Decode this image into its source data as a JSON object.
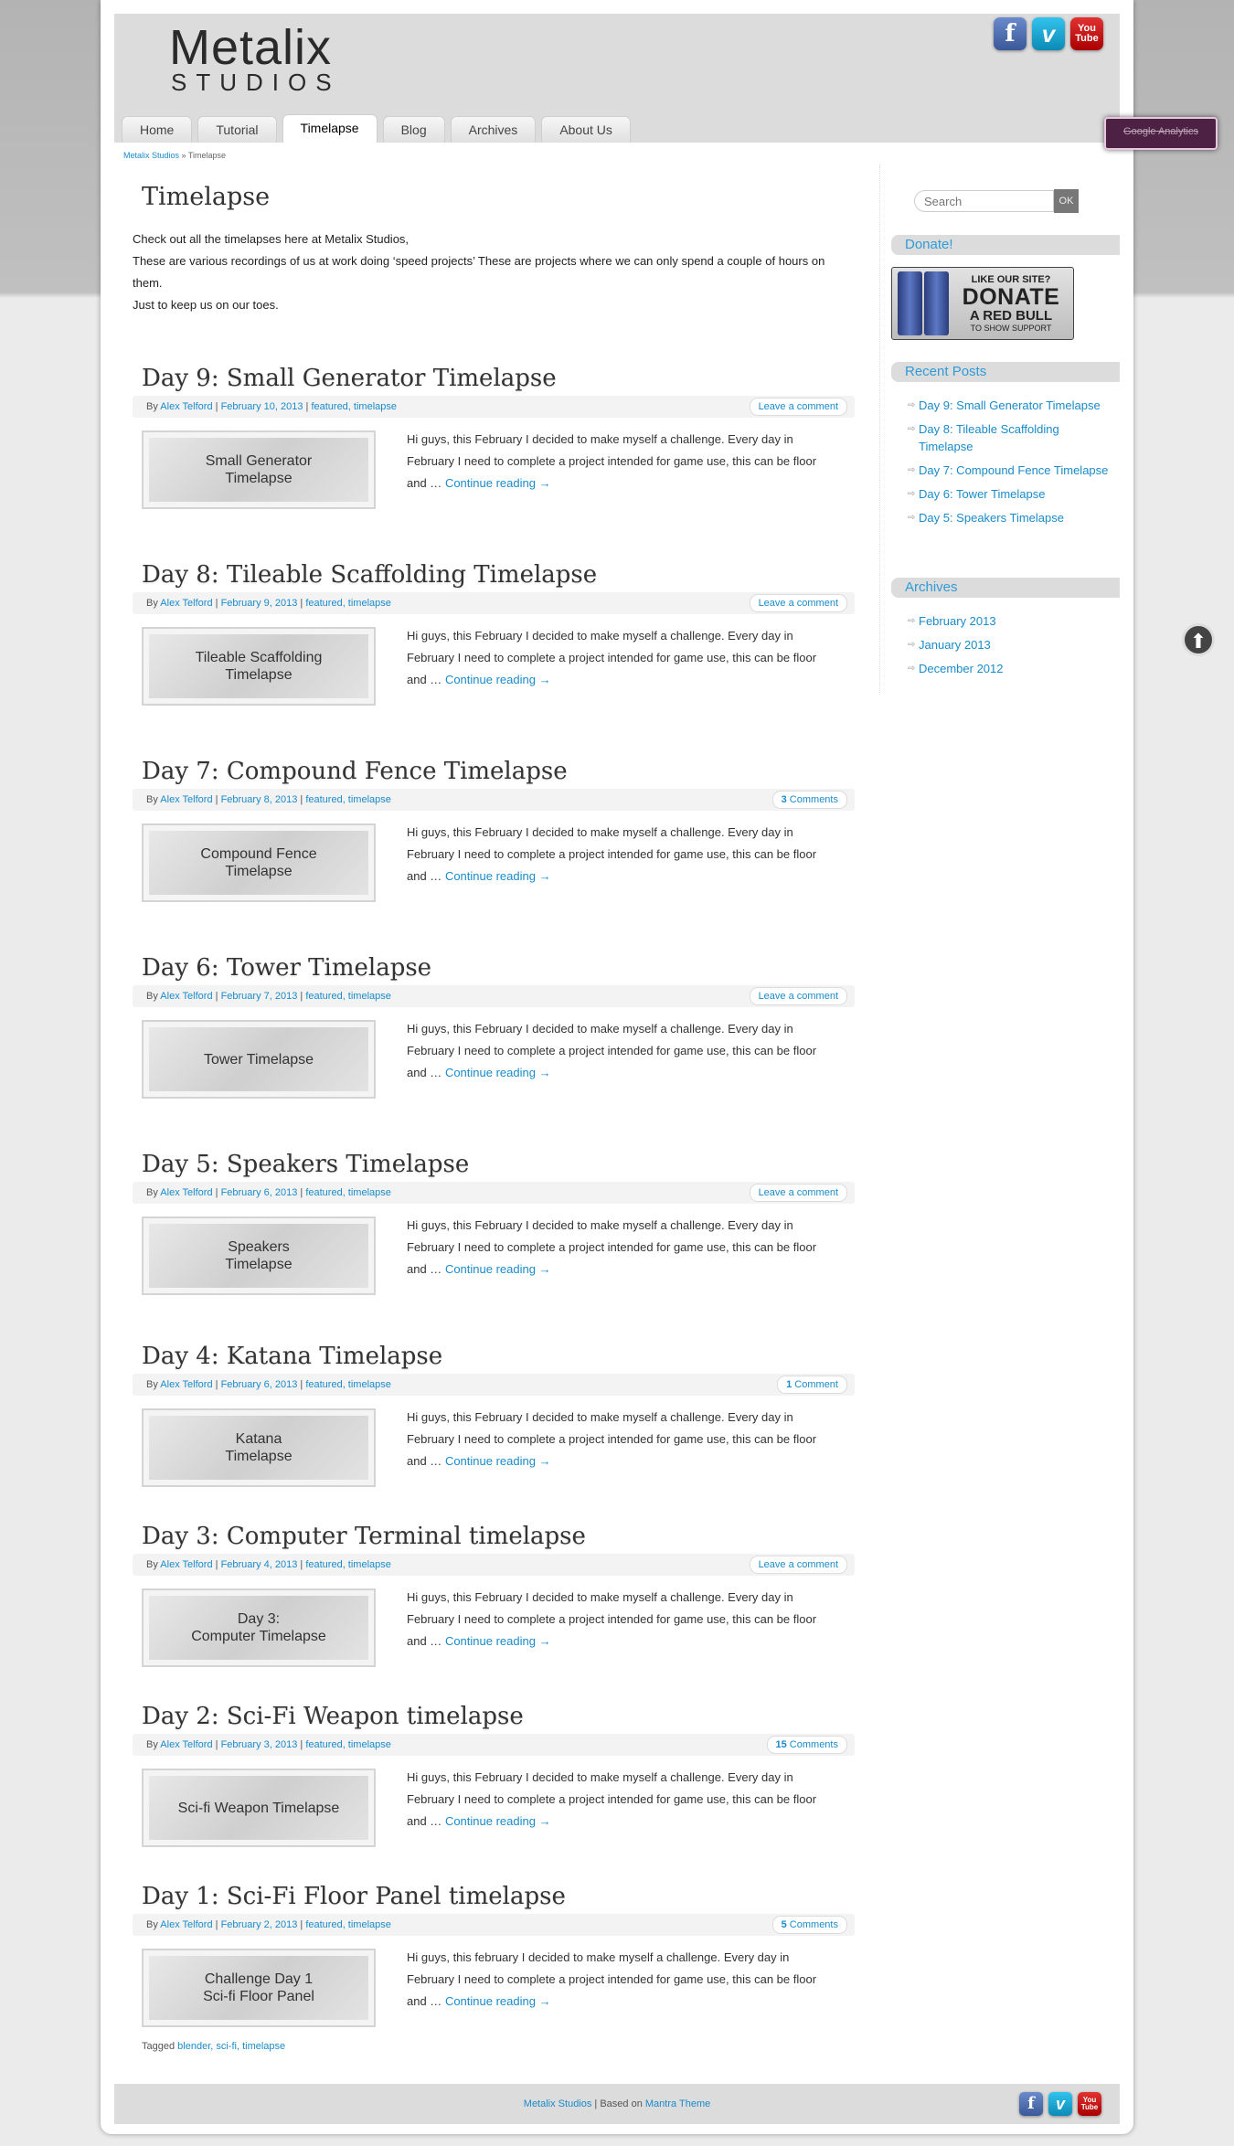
{
  "logo": {
    "line1": "Metalix",
    "line2": "STUDIOS"
  },
  "header_social": [
    {
      "icon": "facebook-icon",
      "glyph": "f"
    },
    {
      "icon": "vimeo-icon",
      "glyph": "v"
    },
    {
      "icon": "youtube-icon",
      "glyph": "You\nTube"
    }
  ],
  "nav": {
    "tabs": [
      {
        "label": "Home",
        "active": false
      },
      {
        "label": "Tutorial",
        "active": false
      },
      {
        "label": "Timelapse",
        "active": true
      },
      {
        "label": "Blog",
        "active": false
      },
      {
        "label": "Archives",
        "active": false
      },
      {
        "label": "About Us",
        "active": false
      }
    ]
  },
  "ga_button": {
    "label": "Google Analytics"
  },
  "breadcrumb": {
    "home": "Metalix Studios",
    "separator": " » ",
    "current": "Timelapse"
  },
  "page": {
    "title": "Timelapse",
    "intro": [
      "Check out all the timelapses here at Metalix Studios,",
      "These are various recordings of us at work doing ‘speed projects’ These are projects where we can only spend a couple of hours on them.",
      "Just to keep us on our toes."
    ]
  },
  "post_common": {
    "by": "By ",
    "author": "Alex Telford",
    "sep": " | ",
    "continue": "Continue reading →"
  },
  "posts": [
    {
      "title": "Day 9: Small Generator Timelapse",
      "date": "February 10, 2013",
      "cats": "featured, timelapse",
      "comment_count": "",
      "comment_text": "Leave a comment",
      "thumb": "Small Generator\nTimelapse",
      "excerpt": "Hi guys, this February I decided to make myself a challenge. Every day in February I need to complete a project intended for game use, this can be floor and …"
    },
    {
      "title": "Day 8: Tileable Scaffolding Timelapse",
      "date": "February 9, 2013",
      "cats": "featured, timelapse",
      "comment_count": "",
      "comment_text": "Leave a comment",
      "thumb": "Tileable Scaffolding\nTimelapse",
      "excerpt": "Hi guys, this February I decided to make myself a challenge. Every day in February I need to complete a project intended for game use, this can be floor and …"
    },
    {
      "title": "Day 7: Compound Fence Timelapse",
      "date": "February 8, 2013",
      "cats": "featured, timelapse",
      "comment_count": "3",
      "comment_text": " Comments",
      "thumb": "Compound Fence\nTimelapse",
      "excerpt": "Hi guys, this February I decided to make myself a challenge. Every day in February I need to complete a project intended for game use, this can be floor and …"
    },
    {
      "title": "Day 6: Tower Timelapse",
      "date": "February 7, 2013",
      "cats": "featured, timelapse",
      "comment_count": "",
      "comment_text": "Leave a comment",
      "thumb": "Tower Timelapse",
      "excerpt": "Hi guys, this February I decided to make myself a challenge. Every day in February I need to complete a project intended for game use, this can be floor and …"
    },
    {
      "title": "Day 5: Speakers Timelapse",
      "date": "February 6, 2013",
      "cats": "featured, timelapse",
      "comment_count": "",
      "comment_text": "Leave a comment",
      "thumb": "Speakers\nTimelapse",
      "excerpt": "Hi guys, this February I decided to make myself a challenge. Every day in February I need to complete a project intended for game use, this can be floor and …"
    },
    {
      "title": "Day 4: Katana Timelapse",
      "date": "February 6, 2013",
      "cats": "featured, timelapse",
      "comment_count": "1",
      "comment_text": " Comment",
      "thumb": "Katana\nTimelapse",
      "excerpt": "Hi guys, this February I decided to make myself a challenge. Every day in February I need to complete a project intended for game use, this can be floor and …"
    },
    {
      "title": "Day 3: Computer Terminal timelapse",
      "date": "February 4, 2013",
      "cats": "featured, timelapse",
      "comment_count": "",
      "comment_text": "Leave a comment",
      "thumb": "Day 3:\nComputer Timelapse",
      "excerpt": "Hi guys, this February I decided to make myself a challenge. Every day in February I need to complete a project intended for game use, this can be floor and …"
    },
    {
      "title": "Day 2: Sci-Fi Weapon timelapse",
      "date": "February 3, 2013",
      "cats": "featured, timelapse",
      "comment_count": "15",
      "comment_text": " Comments",
      "thumb": "Sci-fi Weapon Timelapse",
      "excerpt": "Hi guys, this February I decided to make myself a challenge. Every day in February I need to complete a project intended for game use, this can be floor and …"
    },
    {
      "title": "Day 1: Sci-Fi Floor Panel timelapse",
      "date": "February 2, 2013",
      "cats": "featured, timelapse",
      "comment_count": "5",
      "comment_text": " Comments",
      "thumb": "Challenge Day 1\nSci-fi Floor Panel",
      "excerpt": "Hi guys, this february I decided to make myself a challenge. Every day in February I need to complete a project intended for game use, this can be floor and …"
    }
  ],
  "tagged": {
    "label": "Tagged ",
    "tags": "blender, sci-fi, timelapse"
  },
  "sidebar": {
    "search_placeholder": "Search",
    "search_button": "OK",
    "donate_title": "Donate!",
    "donate_banner": {
      "line1": "LIKE OUR SITE?",
      "line2": "DONATE",
      "line3": "A RED BULL",
      "line4": "TO SHOW SUPPORT"
    },
    "recent_title": "Recent Posts",
    "recent": [
      "Day 9: Small Generator Timelapse",
      "Day 8: Tileable Scaffolding Timelapse",
      "Day 7: Compound Fence Timelapse",
      "Day 6: Tower Timelapse",
      "Day 5: Speakers Timelapse"
    ],
    "archives_title": "Archives",
    "archives": [
      "February 2013",
      "January 2013",
      "December 2012"
    ]
  },
  "scroll_top": {
    "icon": "arrow-up-circle-icon",
    "glyph": "⬆"
  },
  "footer": {
    "site": "Metalix Studios",
    "based": " | Based on ",
    "theme": "Mantra Theme"
  }
}
